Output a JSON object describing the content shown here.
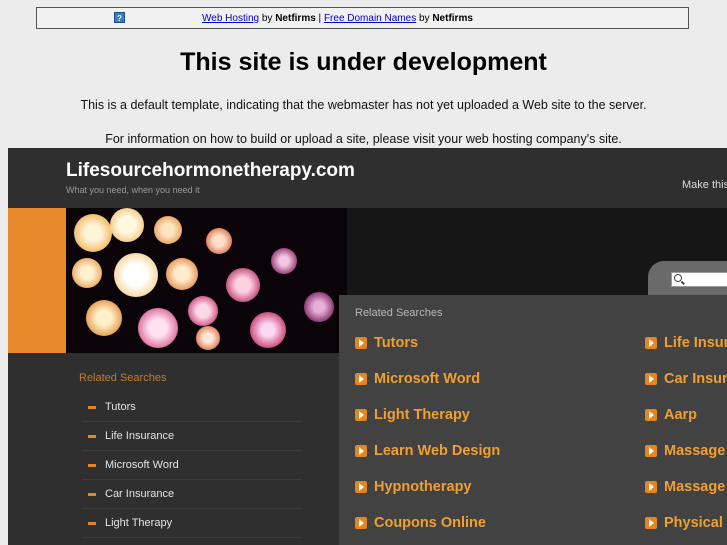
{
  "topbar": {
    "web_hosting_link": "Web Hosting",
    "by1": " by ",
    "brand1": "Netfirms",
    "separator": " | ",
    "free_domain_link": "Free Domain Names",
    "by2": " by ",
    "brand2": "Netfirms",
    "help_icon": "?"
  },
  "notice": {
    "title": "This site is under development",
    "line1": "This is a default template, indicating that the webmaster has not yet uploaded a Web site to the server.",
    "line2": "For information on how to build or upload a site, please visit your web hosting company's site."
  },
  "parked": {
    "site_name": "Lifesourcehormonetherapy.com",
    "tagline": "What you need, when you need it",
    "make_text": "Make this",
    "main_heading": "Related Searches",
    "main_left": [
      "Tutors",
      "Microsoft Word",
      "Light Therapy",
      "Learn Web Design",
      "Hypnotherapy",
      "Coupons Online"
    ],
    "main_right": [
      "Life Insurance",
      "Car Insurance",
      "Aarp",
      "Massage",
      "Massage",
      "Physical"
    ],
    "side_heading": "Related Searches",
    "side_items": [
      "Tutors",
      "Life Insurance",
      "Microsoft Word",
      "Car Insurance",
      "Light Therapy"
    ],
    "accent_color": "#e98a2a",
    "link_color": "#f0a030"
  }
}
